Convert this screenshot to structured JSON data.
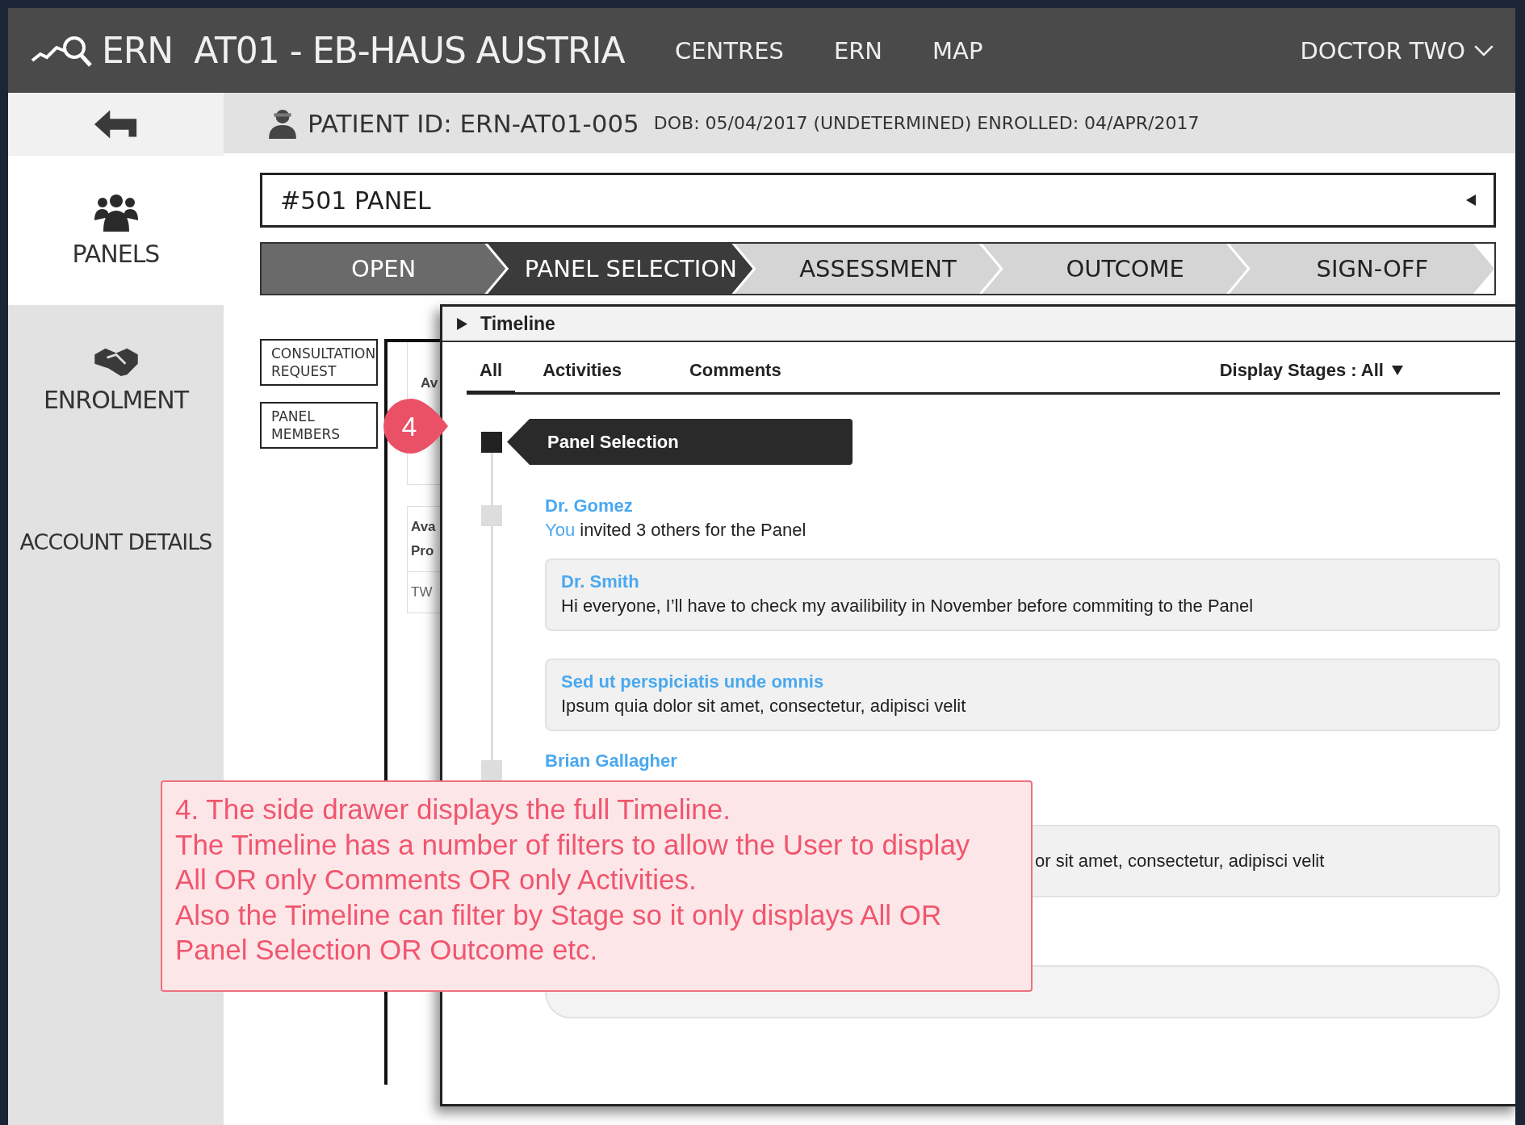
{
  "header": {
    "title": "ERN  AT01 - EB-HAUS AUSTRIA",
    "nav": [
      "CENTRES",
      "ERN",
      "MAP"
    ],
    "user": "DOCTOR TWO"
  },
  "sidebar": {
    "items": [
      {
        "kind": "back",
        "selected": false
      },
      {
        "kind": "panels",
        "label": "PANELS",
        "selected": true
      },
      {
        "kind": "enrolment",
        "label": "ENROLMENT",
        "selected": false
      },
      {
        "kind": "account",
        "label": "ACCOUNT DETAILS",
        "selected": false
      }
    ]
  },
  "patient": {
    "id": "PATIENT ID: ERN-AT01-005",
    "details": "DOB: 05/04/2017 (UNDETERMINED) ENROLLED: 04/APR/2017"
  },
  "panel_select": {
    "value": "#501 PANEL"
  },
  "stepper": [
    {
      "label": "OPEN",
      "completed": true,
      "selected": false
    },
    {
      "label": "PANEL SELECTION",
      "completed": false,
      "selected": true
    },
    {
      "label": "ASSESSMENT",
      "completed": false,
      "selected": false
    },
    {
      "label": "OUTCOME",
      "completed": false,
      "selected": false
    },
    {
      "label": "SIGN-OFF",
      "completed": false,
      "selected": false
    }
  ],
  "sub_tabs": [
    {
      "label": "CONSULTATION\nREQUEST"
    },
    {
      "label": "PANEL\nMEMBERS"
    }
  ],
  "background_cards": [
    {
      "lines": [
        "Av"
      ]
    },
    {
      "lines": [
        "Ava",
        "Pro"
      ]
    },
    {
      "lines": [
        "TW"
      ]
    }
  ],
  "timeline": {
    "title": "Timeline",
    "filters": [
      {
        "label": "All",
        "selected": true
      },
      {
        "label": "Activities",
        "selected": false
      },
      {
        "label": "Comments",
        "selected": false
      }
    ],
    "display_stages": "Display Stages : All",
    "stage_marker": "Panel Selection",
    "entries": [
      {
        "kind": "event",
        "author": "Dr. Gomez",
        "actor": "You",
        "text": "invited 3 others for the Panel"
      },
      {
        "kind": "comment",
        "author": "Dr. Smith",
        "text": "Hi everyone, I’ll have to check my availibility in November before commiting to the Panel"
      },
      {
        "kind": "comment",
        "author": "Sed ut perspiciatis unde omnis",
        "text": "Ipsum quia dolor sit amet, consectetur, adipisci velit"
      },
      {
        "kind": "event",
        "author": "Brian Gallagher"
      },
      {
        "kind": "covered_comment",
        "text": "or sit amet, consectetur, adipisci velit"
      }
    ]
  },
  "annotation": {
    "badge": "4",
    "text": "4. The side drawer displays the full Timeline.\nThe Timeline has a number of filters to allow the User to display\nAll OR only Comments OR only Activities.\nAlso the Timeline can filter by Stage so it only displays All OR\nPanel Selection OR Outcome etc."
  }
}
